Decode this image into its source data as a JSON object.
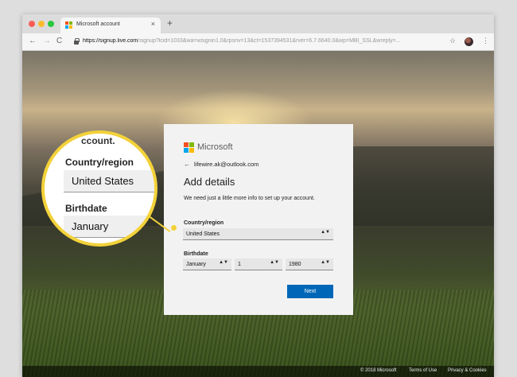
{
  "browser": {
    "tab_title": "Microsoft account",
    "tab_close": "×",
    "new_tab": "+",
    "url_host": "https://signup.live.com",
    "url_rest": "/signup?lcid=1033&wa=wsignin1.0&rpsnv=13&ct=1537394531&rver=6.7.6640.0&wp=MBI_SSL&wreply=...",
    "back_icon": "←",
    "forward_icon": "→",
    "reload_icon": "C",
    "star_icon": "☆",
    "menu_icon": "⋮"
  },
  "colors": {
    "ms_red": "#f25022",
    "ms_green": "#7fba00",
    "ms_blue": "#00a4ef",
    "ms_yellow": "#ffb900",
    "accent": "#0067b8",
    "highlight": "#f3d23a"
  },
  "form": {
    "brand": "Microsoft",
    "back_arrow": "←",
    "email": "lifewire.ak@outlook.com",
    "heading": "Add details",
    "description": "We need just a little more info to set up your account.",
    "country_label": "Country/region",
    "country_value": "United States",
    "birthdate_label": "Birthdate",
    "month_value": "January",
    "day_value": "1",
    "year_value": "1980",
    "next_label": "Next",
    "select_arrow": "▲▼"
  },
  "zoom": {
    "cut_text": "ccount.",
    "country_label": "Country/region",
    "country_value": "United States",
    "birthdate_label": "Birthdate",
    "month_value": "January",
    "select_arrow": "▲▼"
  },
  "footer": {
    "copyright": "© 2018 Microsoft",
    "terms": "Terms of Use",
    "privacy": "Privacy & Cookies"
  }
}
